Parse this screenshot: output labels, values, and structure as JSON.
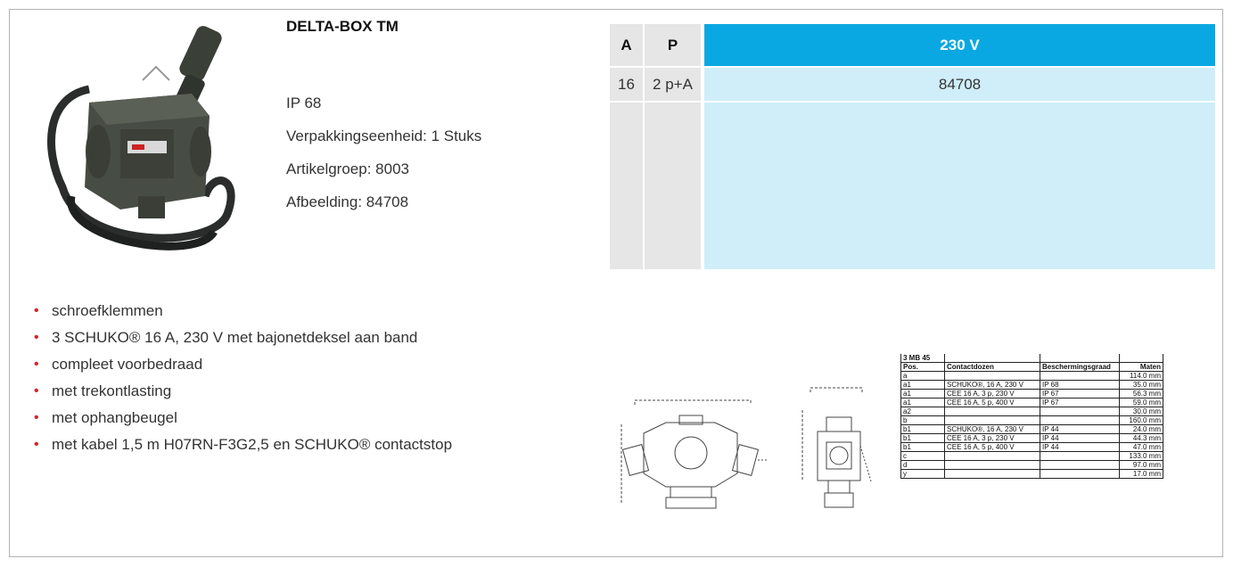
{
  "product": {
    "title": "DELTA-BOX TM",
    "ip": "IP 68",
    "packaging": "Verpakkingseenheid: 1 Stuks",
    "group": "Artikelgroep: 8003",
    "image_ref": "Afbeelding: 84708"
  },
  "variant_table": {
    "headers": [
      "A",
      "P",
      "230 V"
    ],
    "rows": [
      [
        "16",
        "2 p+A",
        "84708"
      ]
    ],
    "colors": {
      "header_grey": "#e6e6e6",
      "accent": "#0aa8e2",
      "light_blue": "#cfeefa"
    }
  },
  "features": [
    "schroefklemmen",
    "3 SCHUKO® 16 A, 230 V met bajonetdeksel aan band",
    "compleet voorbedraad",
    "met trekontlasting",
    "met ophangbeugel",
    "met kabel 1,5 m H07RN-F3G2,5 en SCHUKO® contactstop"
  ],
  "bullet_color": "#d2232a",
  "spec_table": {
    "title": "3 MB 45",
    "headers": [
      "Pos.",
      "Contactdozen",
      "Beschermingsgraad",
      "Maten"
    ],
    "rows": [
      [
        "a",
        "",
        "",
        "114.0 mm"
      ],
      [
        "a1",
        "SCHUKO®, 16 A, 230 V",
        "IP 68",
        "35.0 mm"
      ],
      [
        "a1",
        "CEE 16 A, 3 p, 230 V",
        "IP 67",
        "56.3 mm"
      ],
      [
        "a1",
        "CEE 16 A, 5 p, 400 V",
        "IP 67",
        "59.0 mm"
      ],
      [
        "a2",
        "",
        "",
        "30.0 mm"
      ],
      [
        "b",
        "",
        "",
        "160.0 mm"
      ],
      [
        "b1",
        "SCHUKO®, 16 A, 230 V",
        "IP 44",
        "24.0 mm"
      ],
      [
        "b1",
        "CEE 16 A, 3 p, 230 V",
        "IP 44",
        "44.3 mm"
      ],
      [
        "b1",
        "CEE 16 A, 5 p, 400 V",
        "IP 44",
        "47.0 mm"
      ],
      [
        "c",
        "",
        "",
        "133.0 mm"
      ],
      [
        "d",
        "",
        "",
        "97.0 mm"
      ],
      [
        "y",
        "",
        "",
        "17.0 mm"
      ]
    ]
  }
}
